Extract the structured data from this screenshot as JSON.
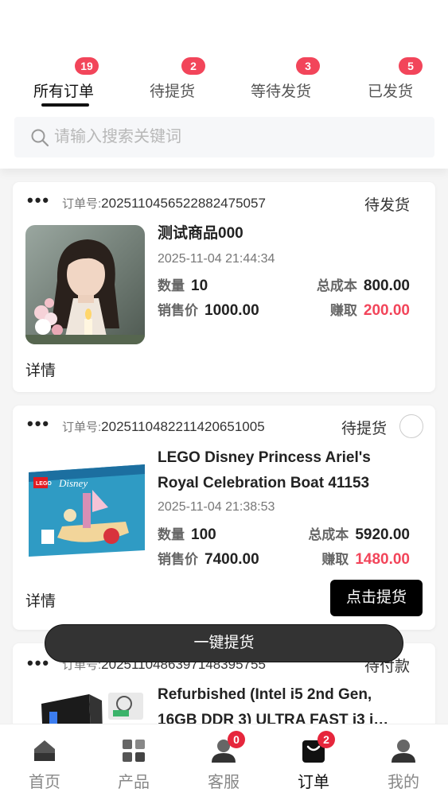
{
  "tabs": [
    {
      "label": "所有订单",
      "count": "19",
      "active": true
    },
    {
      "label": "待提货",
      "count": "2"
    },
    {
      "label": "等待发货",
      "count": "3"
    },
    {
      "label": "已发货",
      "count": "5"
    }
  ],
  "search": {
    "placeholder": "请输入搜索关键词"
  },
  "orders": [
    {
      "dots": "•••",
      "order_no_label": "订单号:",
      "order_no": "2025110456522882475057",
      "status": "待发货",
      "product_name": "测试商品000",
      "time": "2025-11-04 21:44:34",
      "qty_label": "数量",
      "qty": "10",
      "cost_label": "总成本",
      "cost": "800.00",
      "price_label": "销售价",
      "price": "1000.00",
      "earn_label": "赚取",
      "earn": "200.00",
      "details_label": "详情"
    },
    {
      "dots": "•••",
      "order_no_label": "订单号:",
      "order_no": "2025110482211420651005",
      "status": "待提货",
      "product_name": "LEGO Disney Princess Ariel's Royal Celebration Boat 41153",
      "time": "2025-11-04 21:38:53",
      "qty_label": "数量",
      "qty": "100",
      "cost_label": "总成本",
      "cost": "5920.00",
      "price_label": "销售价",
      "price": "7400.00",
      "earn_label": "赚取",
      "earn": "1480.00",
      "details_label": "详情",
      "action_label": "点击提货"
    },
    {
      "dots": "•••",
      "order_no_label": "订单号:",
      "order_no": "2025110486397148395755",
      "status": "待付款",
      "product_name": "Refurbished (Intel i5 2nd Gen, 16GB DDR 3) ULTRA FAST i3 i…"
    }
  ],
  "bulk_button": "一键提货",
  "tabbar": [
    {
      "label": "首页",
      "icon": "home-icon"
    },
    {
      "label": "产品",
      "icon": "grid-icon"
    },
    {
      "label": "客服",
      "icon": "support-icon",
      "badge": "0"
    },
    {
      "label": "订单",
      "icon": "bag-icon",
      "badge": "2",
      "active": true
    },
    {
      "label": "我的",
      "icon": "user-icon"
    }
  ],
  "colors": {
    "accent": "#f2455a",
    "dark_button": "#000000",
    "bulk_button": "#333333"
  }
}
